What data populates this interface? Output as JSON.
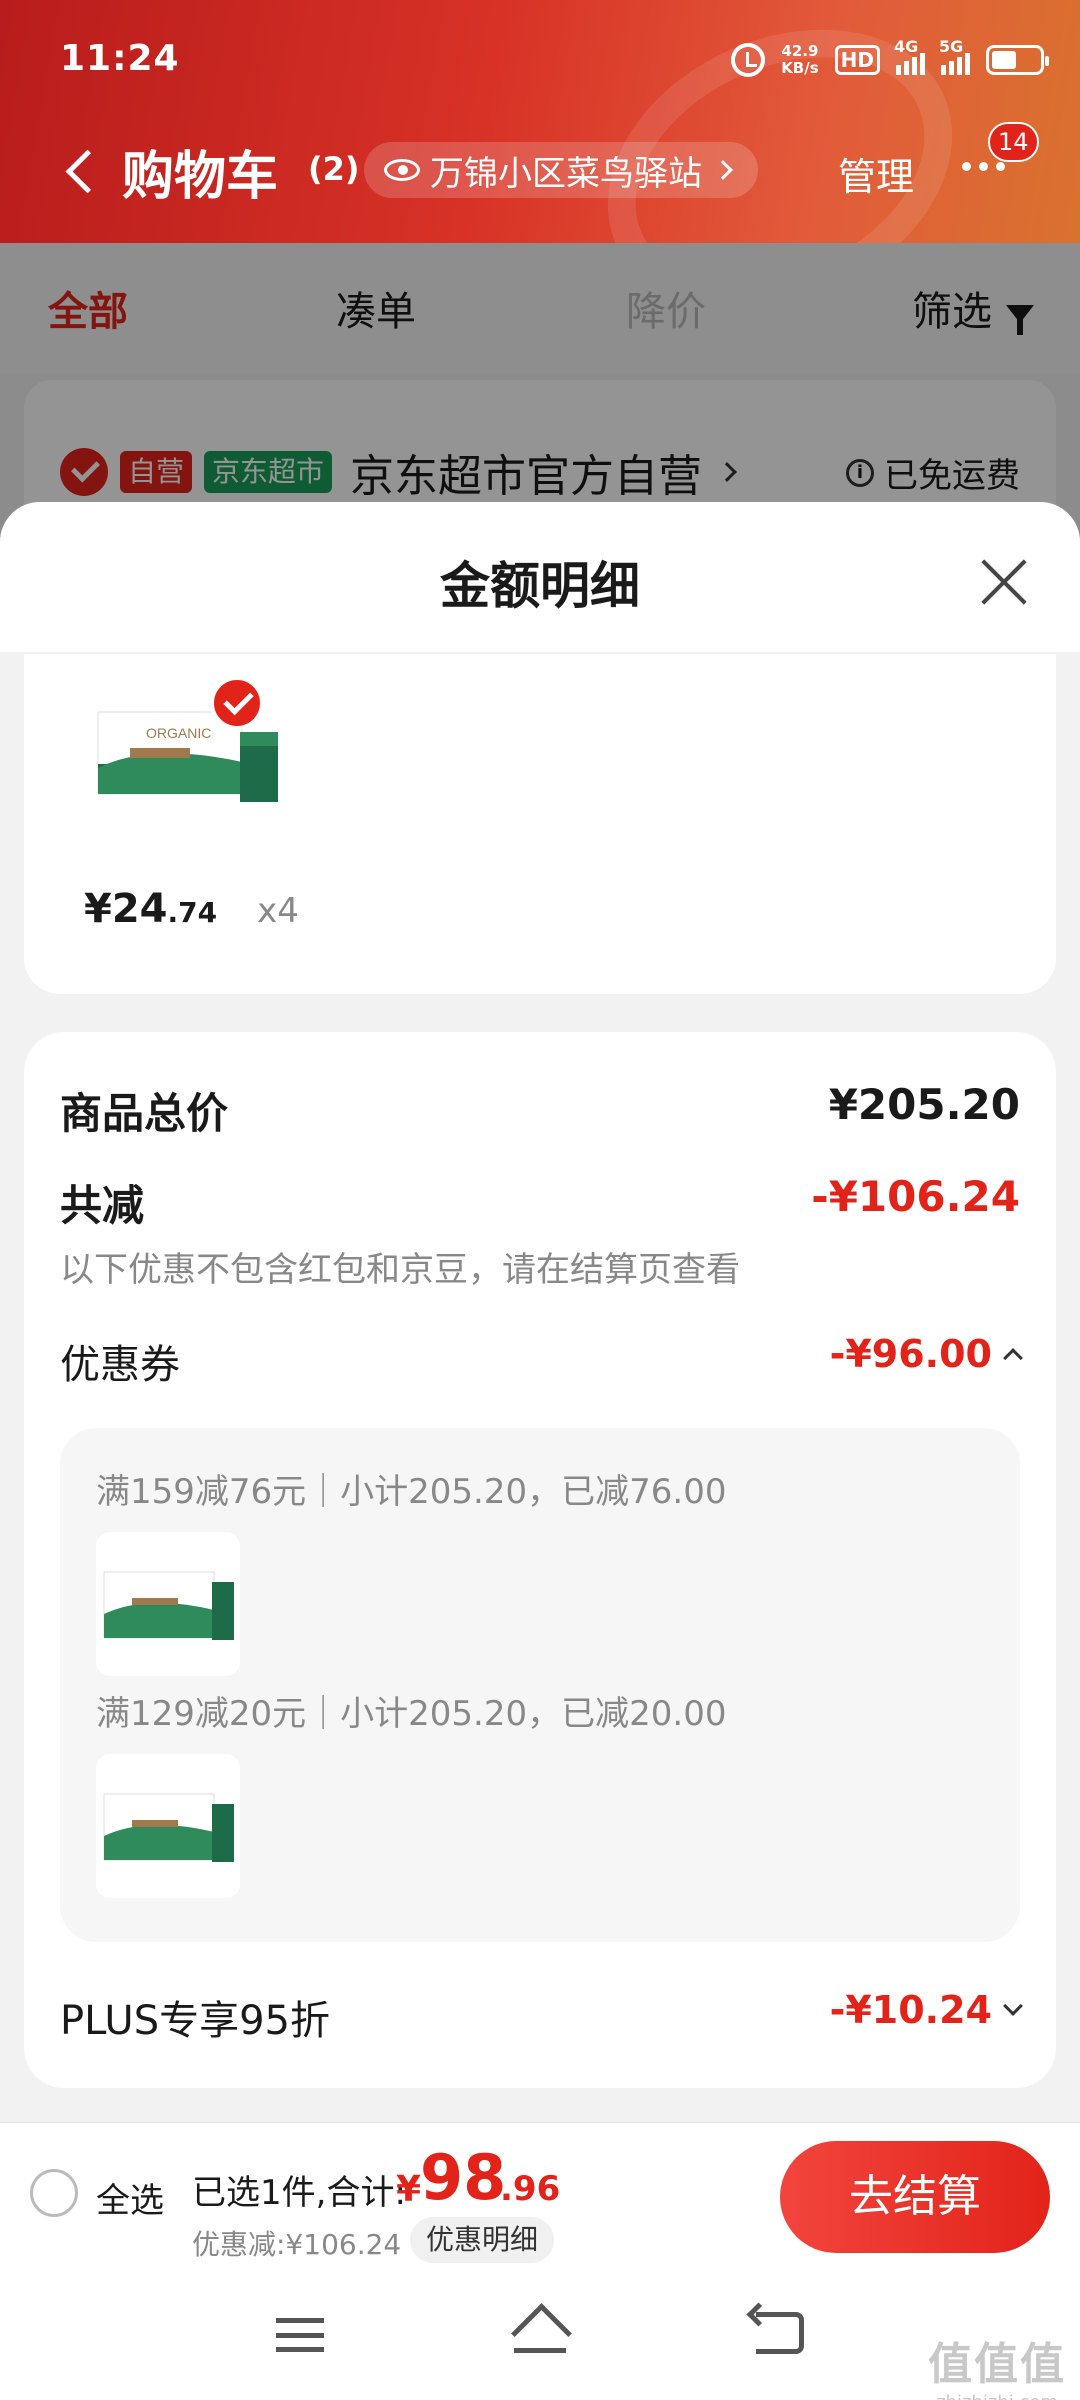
{
  "status_bar": {
    "time": "11:24",
    "net_speed": "42.9",
    "net_unit": "KB/s",
    "hd_label": "HD",
    "sig1_label": "4G",
    "sig2_label": "5G"
  },
  "nav": {
    "title": "购物车",
    "count": "(2)",
    "location": "万锦小区菜鸟驿站",
    "manage": "管理",
    "badge": "14"
  },
  "tabs": [
    {
      "label": "全部"
    },
    {
      "label": "凑单"
    },
    {
      "label": "降价"
    },
    {
      "label": "筛选"
    }
  ],
  "store": {
    "tag_self": "自营",
    "tag_market": "京东超市",
    "name": "京东超市官方自营",
    "shipping": "已免运费"
  },
  "sheet": {
    "title": "金额明细",
    "product": {
      "price_int": "¥24",
      "price_dec": ".74",
      "qty": "x4",
      "thumb_brand": "ORGANIC"
    },
    "summary": {
      "goods_total_label": "商品总价",
      "goods_total": "¥205.20",
      "reduce_label": "共减",
      "reduce_total": "-¥106.24",
      "reduce_note": "以下优惠不包含红包和京豆，请在结算页查看",
      "coupon_label": "优惠券",
      "coupon_total": "-¥96.00",
      "coupons": [
        {
          "text": "满159减76元｜小计205.20，已减76.00"
        },
        {
          "text": "满129减20元｜小计205.20，已减20.00"
        }
      ],
      "plus_label": "PLUS专享95折",
      "plus_total": "-¥10.24"
    }
  },
  "bottom": {
    "select_all": "全选",
    "selected_text": "已选1件,合计:",
    "total_symbol": "¥",
    "total_int": "98",
    "total_dec": ".96",
    "discount_text": "优惠减:¥106.24",
    "detail_button": "优惠明细",
    "checkout": "去结算"
  },
  "watermark": {
    "big": "值值值",
    "small": "zhizhizhi.com"
  },
  "colors": {
    "accent": "#e2231a",
    "green_tag": "#1a9e58",
    "header_start": "#b81c1c",
    "header_end": "#d9722f"
  }
}
